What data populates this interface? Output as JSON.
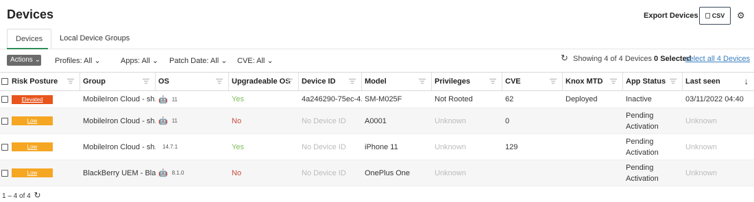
{
  "page": {
    "title": "Devices"
  },
  "header": {
    "export_label": "Export Devices",
    "csv_label": "CSV",
    "csv_icon": "file-icon",
    "settings_icon": "gear-icon"
  },
  "tabs": [
    {
      "label": "Devices",
      "active": true
    },
    {
      "label": "Local Device Groups",
      "active": false
    }
  ],
  "toolbar": {
    "actions_label": "Actions",
    "filters": [
      {
        "label": "Profiles: All"
      },
      {
        "label": "Apps: All"
      },
      {
        "label": "Patch Date: All"
      },
      {
        "label": "CVE: All"
      }
    ],
    "status_text": "Showing 4 of 4 Devices",
    "selected_text": "0 Selected",
    "select_all_link": "select all 4 Devices"
  },
  "table": {
    "columns": [
      "Risk Posture",
      "Group",
      "OS",
      "Upgradeable OS",
      "Device ID",
      "Model",
      "Privileges",
      "CVE",
      "Knox MTD",
      "App Status",
      "Last seen"
    ],
    "rows": [
      {
        "risk": "Elevated",
        "risk_color": "#e8541c",
        "group": "MobileIron Cloud - sh...",
        "os_icon": "android-icon",
        "os_version": "11",
        "upgradeable": "Yes",
        "device_id": "4a246290-75ec-4...",
        "model": "SM-M025F",
        "privileges": "Not Rooted",
        "cve": "62",
        "knox": "Deployed",
        "app_status": "Inactive",
        "last_seen": "03/11/2022 04:40"
      },
      {
        "risk": "Low",
        "risk_color": "#f5a623",
        "group": "MobileIron Cloud - sh...",
        "os_icon": "android-icon",
        "os_version": "11",
        "upgradeable": "No",
        "device_id": "No Device ID",
        "model": "A0001",
        "privileges": "Unknown",
        "cve": "0",
        "knox": "",
        "app_status": "Pending Activation",
        "last_seen": "Unknown"
      },
      {
        "risk": "Low",
        "risk_color": "#f5a623",
        "group": "MobileIron Cloud - sh...",
        "os_icon": "apple-icon",
        "os_version": "14.7.1",
        "upgradeable": "Yes",
        "device_id": "No Device ID",
        "model": "iPhone 11",
        "privileges": "Unknown",
        "cve": "129",
        "knox": "",
        "app_status": "Pending Activation",
        "last_seen": "Unknown"
      },
      {
        "risk": "Low",
        "risk_color": "#f5a623",
        "group": "BlackBerry UEM - Blac...",
        "os_icon": "android-icon",
        "os_version": "8.1.0",
        "upgradeable": "No",
        "device_id": "No Device ID",
        "model": "OnePlus One",
        "privileges": "Unknown",
        "cve": "",
        "knox": "",
        "app_status": "Pending Activation",
        "last_seen": "Unknown"
      }
    ]
  },
  "pagination": {
    "text": "1 – 4 of 4"
  }
}
